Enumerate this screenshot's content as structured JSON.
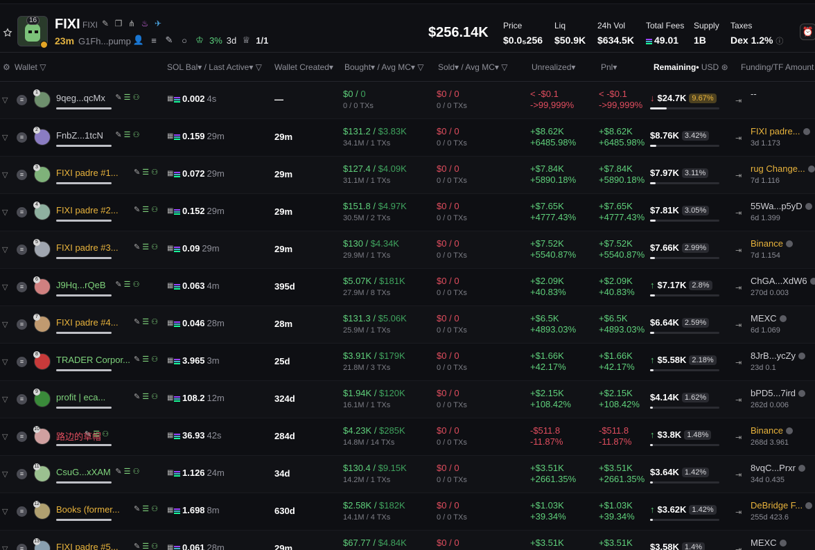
{
  "token": {
    "name": "FIXI",
    "symbol": "FIXI",
    "holders_badge": "16",
    "age": "23m",
    "address": "G1Fh...pump",
    "top10_pct": "3%",
    "top10_age": "3d",
    "ratio": "1/1"
  },
  "header": {
    "market_cap": "$256.14K",
    "stats": [
      {
        "label": "Price",
        "value": "$0.0₅256"
      },
      {
        "label": "Liq",
        "value": "$50.9K"
      },
      {
        "label": "24h Vol",
        "value": "$634.5K"
      },
      {
        "label": "Total Fees",
        "value": "49.01"
      },
      {
        "label": "Supply",
        "value": "1B"
      },
      {
        "label": "Taxes",
        "value": "Dex 1.2%"
      }
    ]
  },
  "columns": {
    "wallet": "Wallet",
    "sol_bal": "SOL Bal",
    "last_active": "/ Last Active",
    "wallet_created": "Wallet Created",
    "bought": "Bought",
    "avg_mc_b": "/ Avg MC",
    "sold": "Sold",
    "avg_mc_s": "/ Avg MC",
    "unrealized": "Unrealized",
    "pnl": "Pnl",
    "remaining": "Remaining",
    "usd": "USD",
    "funding": "Funding/TF Amount"
  },
  "rows": [
    {
      "rank": "1",
      "name": "9qeg...qcMx",
      "name_color": "g",
      "sol": "0.002",
      "active": "4s",
      "created": "—",
      "b1": "$0",
      "b2": "0",
      "bsub": "0 / 0 TXs",
      "s1": "$0",
      "s2": "0",
      "ssub": "0 / 0 TXs",
      "u1": "< -$0.1",
      "u2": "->99,999%",
      "p1": "< -$0.1",
      "p2": "->99,999%",
      "neg": true,
      "rem": "$24.7K",
      "pct": "9.67%",
      "hi": true,
      "arrow": "down",
      "fill": 0.0967,
      "fname": "--",
      "fsub": "",
      "fcolor": "w"
    },
    {
      "rank": "2",
      "name": "FnbZ...1tcN",
      "name_color": "g",
      "sol": "0.159",
      "active": "29m",
      "created": "29m",
      "b1": "$131.2",
      "b2": "$3.83K",
      "bsub": "34.1M / 1 TXs",
      "s1": "$0",
      "s2": "0",
      "ssub": "0 / 0 TXs",
      "u1": "+$8.62K",
      "u2": "+6485.98%",
      "p1": "+$8.62K",
      "p2": "+6485.98%",
      "neg": false,
      "rem": "$8.76K",
      "pct": "3.42%",
      "hi": false,
      "arrow": "",
      "fill": 0.0342,
      "fname": "FIXI padre...",
      "fsub": "3d 1.173",
      "fcolor": "o"
    },
    {
      "rank": "3",
      "name": "FIXI padre #1...",
      "name_color": "o",
      "sol": "0.072",
      "active": "29m",
      "created": "29m",
      "b1": "$127.4",
      "b2": "$4.09K",
      "bsub": "31.1M / 1 TXs",
      "s1": "$0",
      "s2": "0",
      "ssub": "0 / 0 TXs",
      "u1": "+$7.84K",
      "u2": "+5890.18%",
      "p1": "+$7.84K",
      "p2": "+5890.18%",
      "neg": false,
      "rem": "$7.97K",
      "pct": "3.11%",
      "hi": false,
      "arrow": "",
      "fill": 0.0311,
      "fname": "rug Change...",
      "fsub": "7d 1.116",
      "fcolor": "o"
    },
    {
      "rank": "4",
      "name": "FIXI padre #2...",
      "name_color": "o",
      "sol": "0.152",
      "active": "29m",
      "created": "29m",
      "b1": "$151.8",
      "b2": "$4.97K",
      "bsub": "30.5M / 2 TXs",
      "s1": "$0",
      "s2": "0",
      "ssub": "0 / 0 TXs",
      "u1": "+$7.65K",
      "u2": "+4777.43%",
      "p1": "+$7.65K",
      "p2": "+4777.43%",
      "neg": false,
      "rem": "$7.81K",
      "pct": "3.05%",
      "hi": false,
      "arrow": "",
      "fill": 0.0305,
      "fname": "55Wa...p5yD",
      "fsub": "6d 1.399",
      "fcolor": "w"
    },
    {
      "rank": "5",
      "name": "FIXI padre #3...",
      "name_color": "o",
      "sol": "0.09",
      "active": "29m",
      "created": "29m",
      "b1": "$130",
      "b2": "$4.34K",
      "bsub": "29.9M / 1 TXs",
      "s1": "$0",
      "s2": "0",
      "ssub": "0 / 0 TXs",
      "u1": "+$7.52K",
      "u2": "+5540.87%",
      "p1": "+$7.52K",
      "p2": "+5540.87%",
      "neg": false,
      "rem": "$7.66K",
      "pct": "2.99%",
      "hi": false,
      "arrow": "",
      "fill": 0.0299,
      "fname": "Binance",
      "fsub": "7d 1.154",
      "fcolor": "o"
    },
    {
      "rank": "6",
      "name": "J9Hq...rQeB",
      "name_color": "gr",
      "sol": "0.063",
      "active": "4m",
      "created": "395d",
      "b1": "$5.07K",
      "b2": "$181K",
      "bsub": "27.9M / 8 TXs",
      "s1": "$0",
      "s2": "0",
      "ssub": "0 / 0 TXs",
      "u1": "+$2.09K",
      "u2": "+40.83%",
      "p1": "+$2.09K",
      "p2": "+40.83%",
      "neg": false,
      "rem": "$7.17K",
      "pct": "2.8%",
      "hi": false,
      "arrow": "up",
      "fill": 0.028,
      "fname": "ChGA...XdW6",
      "fsub": "270d 0.003",
      "fcolor": "w"
    },
    {
      "rank": "7",
      "name": "FIXI padre #4...",
      "name_color": "o",
      "sol": "0.046",
      "active": "28m",
      "created": "28m",
      "b1": "$131.3",
      "b2": "$5.06K",
      "bsub": "25.9M / 1 TXs",
      "s1": "$0",
      "s2": "0",
      "ssub": "0 / 0 TXs",
      "u1": "+$6.5K",
      "u2": "+4893.03%",
      "p1": "+$6.5K",
      "p2": "+4893.03%",
      "neg": false,
      "rem": "$6.64K",
      "pct": "2.59%",
      "hi": false,
      "arrow": "",
      "fill": 0.0259,
      "fname": "MEXC",
      "fsub": "6d 1.069",
      "fcolor": "w"
    },
    {
      "rank": "8",
      "name": "TRADER Corpor...",
      "name_color": "gr",
      "sol": "3.965",
      "active": "3m",
      "created": "25d",
      "b1": "$3.91K",
      "b2": "$179K",
      "bsub": "21.8M / 3 TXs",
      "s1": "$0",
      "s2": "0",
      "ssub": "0 / 0 TXs",
      "u1": "+$1.66K",
      "u2": "+42.17%",
      "p1": "+$1.66K",
      "p2": "+42.17%",
      "neg": false,
      "rem": "$5.58K",
      "pct": "2.18%",
      "hi": false,
      "arrow": "up",
      "fill": 0.0218,
      "fname": "8JrB...ycZy",
      "fsub": "23d 0.1",
      "fcolor": "w"
    },
    {
      "rank": "9",
      "name": "profit | eca...",
      "name_color": "gr",
      "sol": "108.2",
      "active": "12m",
      "created": "324d",
      "b1": "$1.94K",
      "b2": "$120K",
      "bsub": "16.1M / 1 TXs",
      "s1": "$0",
      "s2": "0",
      "ssub": "0 / 0 TXs",
      "u1": "+$2.15K",
      "u2": "+108.42%",
      "p1": "+$2.15K",
      "p2": "+108.42%",
      "neg": false,
      "rem": "$4.14K",
      "pct": "1.62%",
      "hi": false,
      "arrow": "",
      "fill": 0.0162,
      "fname": "bPD5...7ird",
      "fsub": "262d 0.006",
      "fcolor": "w"
    },
    {
      "rank": "10",
      "name": "路边的草帽",
      "name_color": "r",
      "sol": "36.93",
      "active": "42s",
      "created": "284d",
      "b1": "$4.23K",
      "b2": "$285K",
      "bsub": "14.8M / 14 TXs",
      "s1": "$0",
      "s2": "0",
      "ssub": "0 / 0 TXs",
      "u1": "-$511.8",
      "u2": "-11.87%",
      "p1": "-$511.8",
      "p2": "-11.87%",
      "neg": true,
      "rem": "$3.8K",
      "pct": "1.48%",
      "hi": false,
      "arrow": "up",
      "fill": 0.0148,
      "fname": "Binance",
      "fsub": "268d 3.961",
      "fcolor": "o"
    },
    {
      "rank": "11",
      "name": "CsuG...xXAM",
      "name_color": "gr",
      "sol": "1.126",
      "active": "24m",
      "created": "34d",
      "b1": "$130.4",
      "b2": "$9.15K",
      "bsub": "14.2M / 1 TXs",
      "s1": "$0",
      "s2": "0",
      "ssub": "0 / 0 TXs",
      "u1": "+$3.51K",
      "u2": "+2661.35%",
      "p1": "+$3.51K",
      "p2": "+2661.35%",
      "neg": false,
      "rem": "$3.64K",
      "pct": "1.42%",
      "hi": false,
      "arrow": "",
      "fill": 0.0142,
      "fname": "8vqC...Prxr",
      "fsub": "34d 0.435",
      "fcolor": "w"
    },
    {
      "rank": "12",
      "name": "Books (former...",
      "name_color": "o",
      "sol": "1.698",
      "active": "8m",
      "created": "630d",
      "b1": "$2.58K",
      "b2": "$182K",
      "bsub": "14.1M / 4 TXs",
      "s1": "$0",
      "s2": "0",
      "ssub": "0 / 0 TXs",
      "u1": "+$1.03K",
      "u2": "+39.34%",
      "p1": "+$1.03K",
      "p2": "+39.34%",
      "neg": false,
      "rem": "$3.62K",
      "pct": "1.42%",
      "hi": false,
      "arrow": "up",
      "fill": 0.0142,
      "fname": "DeBridge F...",
      "fsub": "255d 423.6",
      "fcolor": "o"
    },
    {
      "rank": "13",
      "name": "FIXI padre #5...",
      "name_color": "o",
      "sol": "0.061",
      "active": "28m",
      "created": "29m",
      "b1": "$67.77",
      "b2": "$4.84K",
      "bsub": "",
      "s1": "$0",
      "s2": "0",
      "ssub": "",
      "u1": "+$3.51K",
      "u2": "",
      "p1": "+$3.51K",
      "p2": "",
      "neg": false,
      "rem": "$3.58K",
      "pct": "1.4%",
      "hi": false,
      "arrow": "",
      "fill": 0.014,
      "fname": "MEXC",
      "fsub": "",
      "fcolor": "w"
    }
  ]
}
